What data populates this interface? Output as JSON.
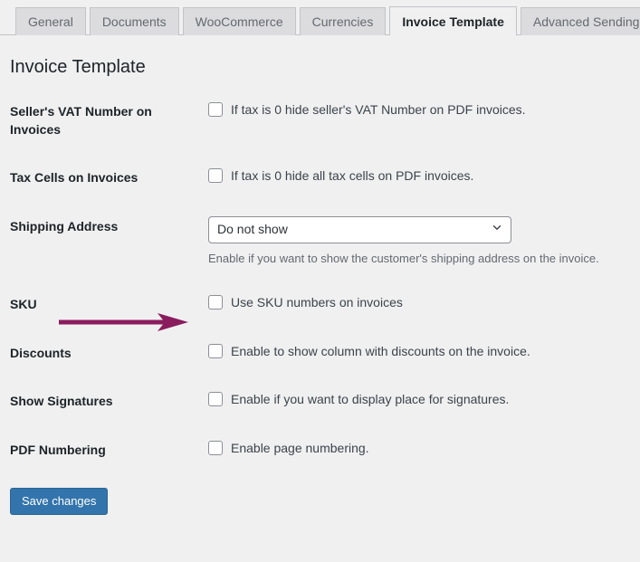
{
  "tabs": [
    {
      "label": "General",
      "active": false
    },
    {
      "label": "Documents",
      "active": false
    },
    {
      "label": "WooCommerce",
      "active": false
    },
    {
      "label": "Currencies",
      "active": false
    },
    {
      "label": "Invoice Template",
      "active": true
    },
    {
      "label": "Advanced Sending",
      "active": false
    }
  ],
  "page": {
    "heading": "Invoice Template"
  },
  "rows": [
    {
      "label": "Seller's VAT Number on Invoices",
      "type": "checkbox",
      "checkbox_label": "If tax is 0 hide seller's VAT Number on PDF invoices.",
      "checked": false
    },
    {
      "label": "Tax Cells on Invoices",
      "type": "checkbox",
      "checkbox_label": "If tax is 0 hide all tax cells on PDF invoices.",
      "checked": false
    },
    {
      "label": "Shipping Address",
      "type": "select",
      "selected": "Do not show",
      "description": "Enable if you want to show the customer's shipping address on the invoice."
    },
    {
      "label": "SKU",
      "type": "checkbox",
      "checkbox_label": "Use SKU numbers on invoices",
      "checked": false,
      "annotated": true
    },
    {
      "label": "Discounts",
      "type": "checkbox",
      "checkbox_label": "Enable to show column with discounts on the invoice.",
      "checked": false
    },
    {
      "label": "Show Signatures",
      "type": "checkbox",
      "checkbox_label": "Enable if you want to display place for signatures.",
      "checked": false
    },
    {
      "label": "PDF Numbering",
      "type": "checkbox",
      "checkbox_label": "Enable page numbering.",
      "checked": false
    }
  ],
  "submit": {
    "label": "Save changes"
  },
  "annotation": {
    "type": "arrow-right",
    "color": "#8a1b5d",
    "points_to": "SKU"
  },
  "colors": {
    "page_background": "#f0f0f1",
    "tab_inactive_background": "#dcdcde",
    "tab_border": "#c3c4c7",
    "label_text": "#1d2327",
    "body_text": "#3c434a",
    "description_text": "#646970",
    "primary_button": "#3274ab",
    "annotation": "#8a1b5d"
  },
  "icons": {
    "chevron_down": "chevron-down-icon"
  }
}
